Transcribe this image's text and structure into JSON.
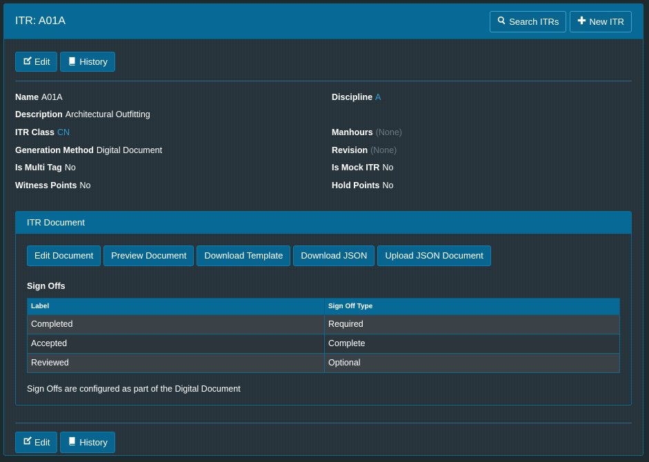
{
  "header": {
    "title": "ITR: A01A",
    "search_label": "Search ITRs",
    "new_label": "New ITR"
  },
  "toolbar": {
    "edit_label": "Edit",
    "history_label": "History"
  },
  "properties": {
    "name": {
      "label": "Name",
      "value": "A01A"
    },
    "discipline": {
      "label": "Discipline",
      "value": "A"
    },
    "description": {
      "label": "Description",
      "value": "Architectural Outfitting"
    },
    "itr_class": {
      "label": "ITR Class",
      "value": "CN"
    },
    "manhours": {
      "label": "Manhours",
      "value": "(None)"
    },
    "generation_method": {
      "label": "Generation Method",
      "value": "Digital Document"
    },
    "revision": {
      "label": "Revision",
      "value": "(None)"
    },
    "is_multi_tag": {
      "label": "Is Multi Tag",
      "value": "No"
    },
    "is_mock_itr": {
      "label": "Is Mock ITR",
      "value": "No"
    },
    "witness_points": {
      "label": "Witness Points",
      "value": "No"
    },
    "hold_points": {
      "label": "Hold Points",
      "value": "No"
    }
  },
  "document": {
    "title": "ITR Document",
    "actions": {
      "edit": "Edit Document",
      "preview": "Preview Document",
      "download_template": "Download Template",
      "download_json": "Download JSON",
      "upload_json": "Upload JSON Document"
    },
    "signoffs_title": "Sign Offs",
    "columns": {
      "label": "Label",
      "type": "Sign Off Type"
    },
    "rows": [
      {
        "label": "Completed",
        "type": "Required"
      },
      {
        "label": "Accepted",
        "type": "Complete"
      },
      {
        "label": "Reviewed",
        "type": "Optional"
      }
    ],
    "note": "Sign Offs are configured as part of the Digital Document"
  },
  "footer_toolbar": {
    "edit_label": "Edit",
    "history_label": "History"
  },
  "colors": {
    "accent": "#076a96",
    "link": "#2d9fd9",
    "muted": "#6b7a82",
    "background": "#27333a"
  }
}
